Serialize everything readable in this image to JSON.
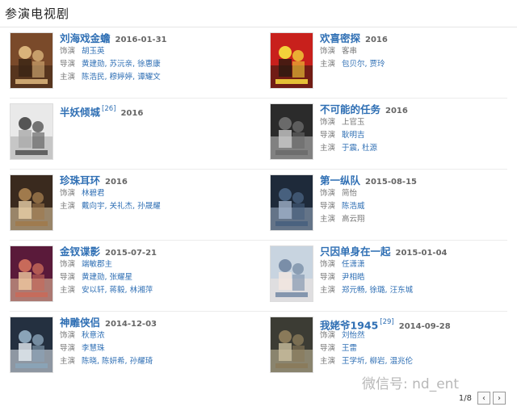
{
  "section": {
    "title": "参演电视剧"
  },
  "labels": {
    "role": "饰演",
    "director": "导演",
    "cast": "主演"
  },
  "items": [
    {
      "title": "刘海戏金蟾",
      "ref": "",
      "year": "2016-01-31",
      "role": "胡玉英",
      "director": "黄建勋, 苏沅亲, 徐惠康",
      "cast": "陈浩民, 穆婷婷, 谭耀文"
    },
    {
      "title": "欢喜密探",
      "ref": "",
      "year": "2016",
      "role": "客串",
      "director": "",
      "cast": "包贝尔, 贾玲"
    },
    {
      "title": "半妖倾城",
      "ref": "[26]",
      "year": "2016",
      "role": "",
      "director": "",
      "cast": ""
    },
    {
      "title": "不可能的任务",
      "ref": "",
      "year": "2016",
      "role": "上官玉",
      "director": "耿明吉",
      "cast": "于震, 杜源"
    },
    {
      "title": "珍珠耳环",
      "ref": "",
      "year": "2016",
      "role": "林碧君",
      "director": "",
      "cast": "戴向宇, 关礼杰, 孙晟耀"
    },
    {
      "title": "第一纵队",
      "ref": "",
      "year": "2015-08-15",
      "role": "简怡",
      "director": "陈浩威",
      "cast": "高云翔"
    },
    {
      "title": "金钗谍影",
      "ref": "",
      "year": "2015-07-21",
      "role": "端敏郡主",
      "director": "黄建勋, 张耀星",
      "cast": "安以轩, 蒋毅, 林湘萍"
    },
    {
      "title": "只因单身在一起",
      "ref": "",
      "year": "2015-01-04",
      "role": "任潇潇",
      "director": "尹相皓",
      "cast": "郑元畅, 徐璐, 汪东城"
    },
    {
      "title": "神雕侠侣",
      "ref": "",
      "year": "2014-12-03",
      "role": "秋意浓",
      "director": "李慧珠",
      "cast": "陈晓, 陈妍希, 孙耀琦"
    },
    {
      "title": "我姥爷1945",
      "ref": "[29]",
      "year": "2014-09-28",
      "role": "刘怡然",
      "director": "王雷",
      "cast": "王学圻, 柳岩, 温兆伦"
    }
  ],
  "watermark": "微信号: nd_ent",
  "pager": {
    "page": "1/8",
    "prev_icon": "chevron-left-icon",
    "next_icon": "chevron-right-icon"
  },
  "colors": {
    "link": "#2f6fb4",
    "label": "#777777"
  }
}
